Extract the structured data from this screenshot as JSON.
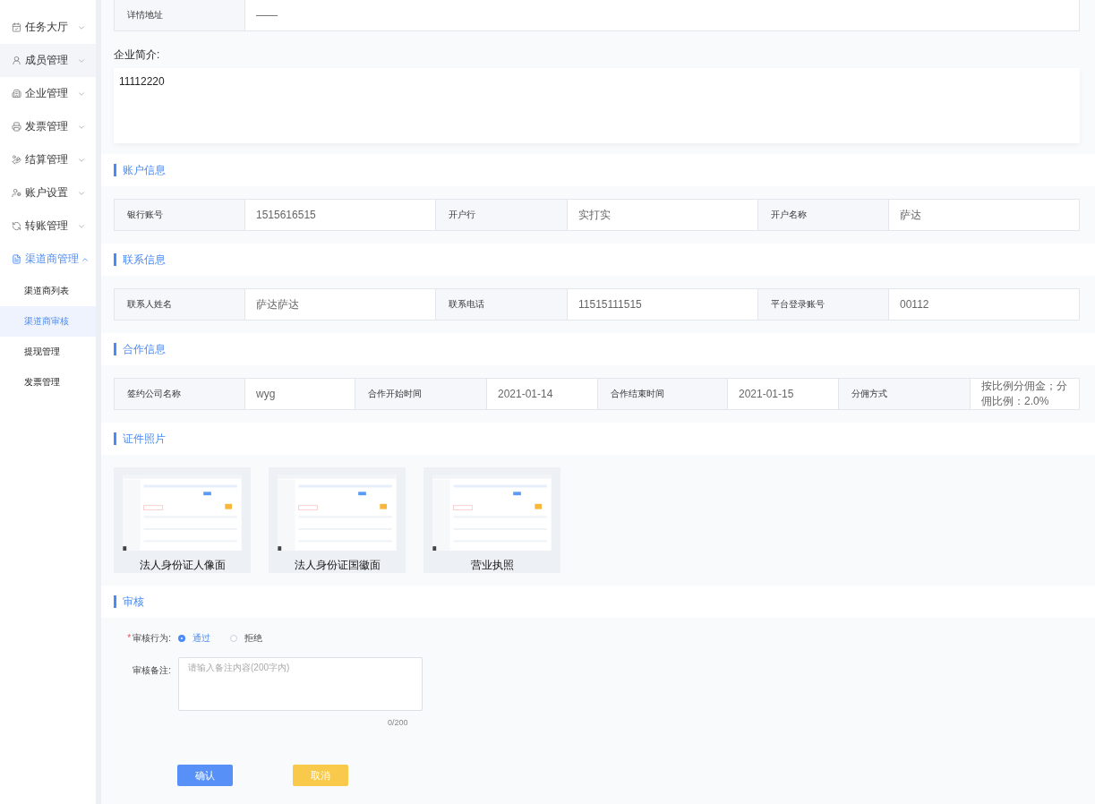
{
  "sidebar": {
    "items": [
      {
        "label": "任务大厅",
        "expanded": false,
        "hovered": false,
        "selected": false
      },
      {
        "label": "成员管理",
        "expanded": false,
        "hovered": true,
        "selected": false
      },
      {
        "label": "企业管理",
        "expanded": false,
        "hovered": false,
        "selected": false
      },
      {
        "label": "发票管理",
        "expanded": false,
        "hovered": false,
        "selected": false
      },
      {
        "label": "结算管理",
        "expanded": false,
        "hovered": false,
        "selected": false
      },
      {
        "label": "账户设置",
        "expanded": false,
        "hovered": false,
        "selected": false
      },
      {
        "label": "转账管理",
        "expanded": false,
        "hovered": false,
        "selected": false
      },
      {
        "label": "渠道商管理",
        "expanded": true,
        "hovered": false,
        "selected": true,
        "children": [
          {
            "label": "渠道商列表",
            "selected": false
          },
          {
            "label": "渠道商审核",
            "selected": true
          },
          {
            "label": "提现管理",
            "selected": false
          },
          {
            "label": "发票管理",
            "selected": false
          }
        ]
      }
    ]
  },
  "address_row": {
    "label": "详情地址",
    "value": "——"
  },
  "intro": {
    "label": "企业简介:",
    "value": "11112220"
  },
  "sections": [
    {
      "title": "账户信息",
      "rows": [
        {
          "label": "银行账号",
          "value": "1515616515"
        },
        {
          "label": "开户行",
          "value": "实打实"
        },
        {
          "label": "开户名称",
          "value": "萨达"
        }
      ]
    },
    {
      "title": "联系信息",
      "rows": [
        {
          "label": "联系人姓名",
          "value": "萨达萨达"
        },
        {
          "label": "联系电话",
          "value": "11515111515"
        },
        {
          "label": "平台登录账号",
          "value": "00112"
        }
      ]
    },
    {
      "title": "合作信息",
      "rows": [
        {
          "label": "签约公司名称",
          "value": "wyg"
        },
        {
          "label": "合作开始时间",
          "value": "2021-01-14"
        },
        {
          "label": "合作结束时间",
          "value": "2021-01-15"
        },
        {
          "label": "分佣方式",
          "value": "按比例分佣金；分佣比例：2.0%"
        }
      ]
    }
  ],
  "photos": {
    "title": "证件照片",
    "items": [
      {
        "kind": "picture",
        "caption": "法人身份证人像面"
      },
      {
        "kind": "picture",
        "caption": "法人身份证国徽面"
      },
      {
        "kind": "picture",
        "caption": "营业执照"
      }
    ]
  },
  "review": {
    "title": "审核",
    "action_label": "审核行为:",
    "required_mark": "*",
    "options": [
      {
        "label": "通过",
        "selected": true
      },
      {
        "label": "拒绝",
        "selected": false
      }
    ],
    "remark_label": "审核备注:",
    "remark_placeholder": "请输入备注内容(200字内)",
    "counter": "0/200",
    "buttons": [
      {
        "label": "确认",
        "kind": "primary"
      },
      {
        "label": "取消",
        "kind": "warning"
      }
    ]
  }
}
